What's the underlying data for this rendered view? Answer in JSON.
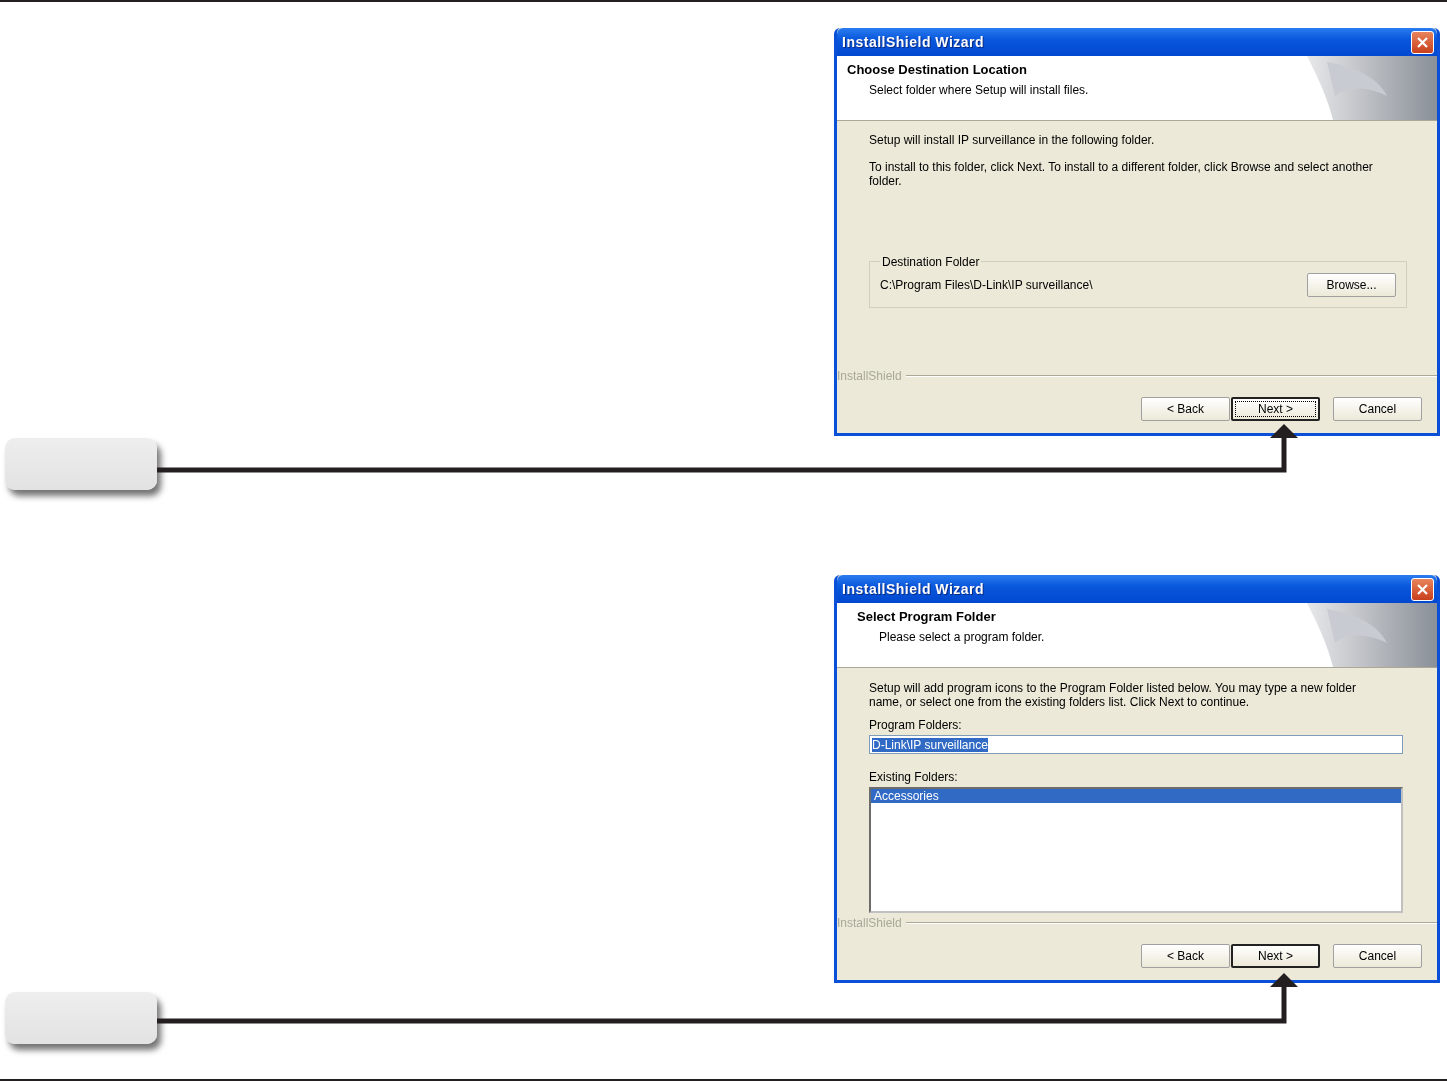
{
  "dialogs": [
    {
      "kind": "destination",
      "title": "InstallShield Wizard",
      "heading": "Choose Destination Location",
      "subheading": "Select folder where Setup will install files.",
      "paragraphs": [
        "Setup will install IP surveillance in the following folder.",
        "To install to this folder, click Next. To install to a different folder, click Browse and select another folder."
      ],
      "group": {
        "label": "Destination Folder",
        "path": "C:\\Program Files\\D-Link\\IP surveillance\\",
        "button": "Browse..."
      },
      "brand": "InstallShield",
      "buttons": [
        {
          "label": "< Back",
          "default": false,
          "focused": false
        },
        {
          "label": "Next >",
          "default": true,
          "focused": true
        },
        {
          "label": "Cancel",
          "default": false,
          "focused": false
        }
      ]
    },
    {
      "kind": "program_folder",
      "title": "InstallShield Wizard",
      "heading": "Select Program Folder",
      "subheading": "Please select a program folder.",
      "paragraphs": [
        "Setup will add program icons to the Program Folder listed below.  You may type a new folder name, or select one from the existing folders list.  Click Next to continue."
      ],
      "program_folders": {
        "label": "Program Folders:",
        "value": "D-Link\\IP surveillance"
      },
      "existing_folders": {
        "label": "Existing Folders:",
        "items": [
          {
            "label": "Accessories",
            "selected": true
          }
        ]
      },
      "brand": "InstallShield",
      "buttons": [
        {
          "label": "< Back",
          "default": false,
          "focused": false
        },
        {
          "label": "Next >",
          "default": true,
          "focused": false
        },
        {
          "label": "Cancel",
          "default": false,
          "focused": false
        }
      ]
    }
  ]
}
